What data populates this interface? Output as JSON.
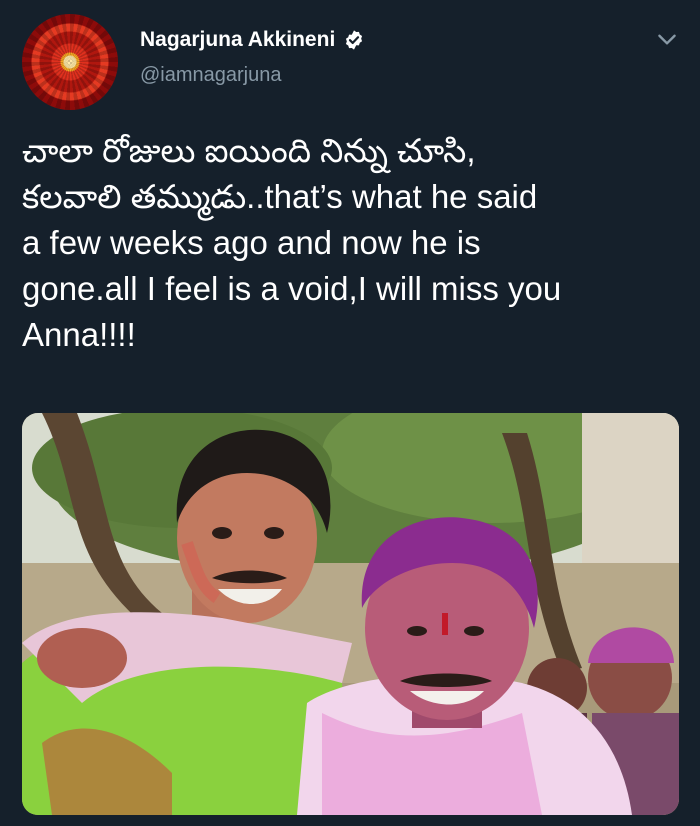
{
  "tweet": {
    "author": {
      "display_name": "Nagarjuna Akkineni",
      "handle": "@iamnagarjuna",
      "verified": true
    },
    "text_lines": [
      "చాలా రోజులు ఐయింది నిన్ను చూసి,",
      "కలవాలి తమ్ముడు..that’s what he said",
      "a few weeks ago and now he is",
      "gone.all I feel is a void,I will miss you",
      "Anna!!!!"
    ],
    "media": {
      "type": "photo"
    }
  },
  "icons": {
    "verified": "verified-badge-icon",
    "menu": "chevron-down-icon"
  },
  "colors": {
    "background": "#15202b",
    "primary_text": "#ffffff",
    "secondary_text": "#8899a6"
  }
}
